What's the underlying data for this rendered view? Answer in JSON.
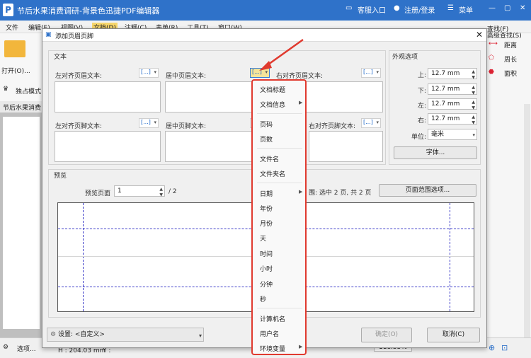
{
  "app": {
    "title": "节后水果消费调研-背景色迅捷PDF编辑器",
    "logo": "P"
  },
  "titlebar": {
    "service": "客服入口",
    "login": "注册/登录",
    "menu": "菜单"
  },
  "menubar": [
    "文件",
    "编辑(E)",
    "视图(V)",
    "文档(D)",
    "注释(C)",
    "表单(R)",
    "工具(T)",
    "窗口(W)"
  ],
  "left": {
    "open_label": "打开(O)...",
    "exclusive_mode": "独占模式",
    "doc_tab": "节后水果消费"
  },
  "right": {
    "quick_find": "查找(F)",
    "advanced_find": "高级查找(S)",
    "distance": "距离",
    "perimeter": "周长",
    "area": "面积"
  },
  "dialog": {
    "title": "添加页眉页脚",
    "text_group": "文本",
    "left_header": "左对齐页眉文本:",
    "center_header": "居中页眉文本:",
    "right_header": "右对齐页眉文本:",
    "left_footer": "左对齐页脚文本:",
    "center_footer": "居中页脚文本:",
    "right_footer": "右对齐页脚文本:",
    "insert_icon": "[...]",
    "appearance": "外观选项",
    "top_label": "上:",
    "top_value": "12.7 mm",
    "bottom_label": "下:",
    "bottom_value": "12.7 mm",
    "left_label": "左:",
    "left_value": "12.7 mm",
    "right_label": "右:",
    "right_value": "12.7 mm",
    "unit_label": "单位:",
    "unit_value": "毫米",
    "font_button": "字体...",
    "preview_group": "预览",
    "preview_page_label": "预览页面",
    "preview_page_value": "1",
    "preview_page_total": "/ 2",
    "page_range_text": "围: 选中 2 页, 共 2 页",
    "page_range_button": "页面范围选项...",
    "settings_label": "设置:",
    "settings_value": "<自定义>",
    "ok_button": "确定(O)",
    "cancel_button": "取消(C)"
  },
  "popup_menu": {
    "items": [
      {
        "label": "文档标题",
        "sub": false
      },
      {
        "label": "文档信息",
        "sub": true
      },
      {
        "label": "页码",
        "sub": false
      },
      {
        "label": "页数",
        "sub": false
      },
      {
        "label": "文件名",
        "sub": false
      },
      {
        "label": "文件夹名",
        "sub": false
      },
      {
        "label": "日期",
        "sub": true
      },
      {
        "label": "年份",
        "sub": false
      },
      {
        "label": "月份",
        "sub": false
      },
      {
        "label": "天",
        "sub": false
      },
      {
        "label": "时间",
        "sub": false
      },
      {
        "label": "小时",
        "sub": false
      },
      {
        "label": "分钟",
        "sub": false
      },
      {
        "label": "秒",
        "sub": false
      },
      {
        "label": "计算机名",
        "sub": false
      },
      {
        "label": "用户名",
        "sub": false
      },
      {
        "label": "环境变量",
        "sub": true
      }
    ]
  },
  "statusbar": {
    "select": "选项...",
    "h_label": "H : 204.03 mm",
    "y_label": "Y :",
    "zoom": "118.55%"
  },
  "colors": {
    "title_bar": "#2f72c9",
    "highlight": "#e03a2f",
    "guide": "#3c3cc8"
  }
}
